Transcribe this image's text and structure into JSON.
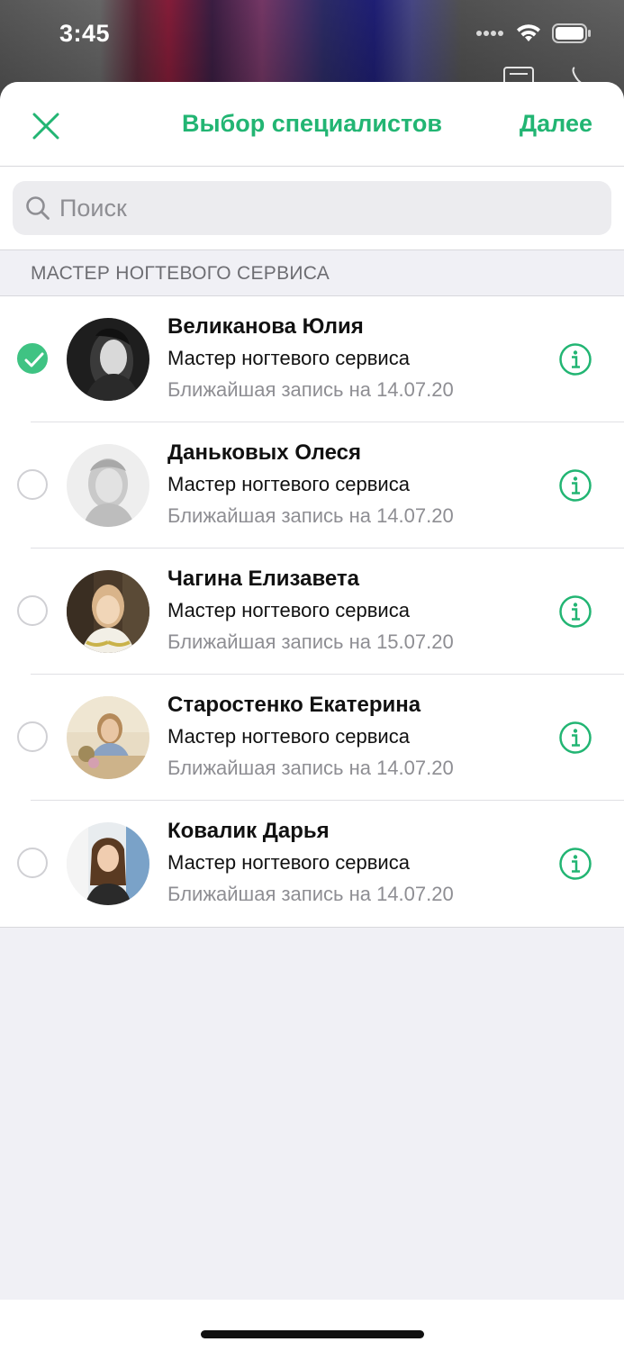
{
  "status_bar": {
    "time": "3:45"
  },
  "nav": {
    "title": "Выбор специалистов",
    "next_label": "Далее"
  },
  "search": {
    "placeholder": "Поиск",
    "value": ""
  },
  "section": {
    "title": "МАСТЕР НОГТЕВОГО СЕРВИСА"
  },
  "accent_color": "#22b573",
  "specialists": [
    {
      "name": "Великанова Юлия",
      "role": "Мастер ногтевого сервиса",
      "next": "Ближайшая запись на 14.07.20",
      "selected": true
    },
    {
      "name": "Даньковых Олеся",
      "role": "Мастер ногтевого сервиса",
      "next": "Ближайшая запись на 14.07.20",
      "selected": false
    },
    {
      "name": "Чагина Елизавета",
      "role": "Мастер ногтевого сервиса",
      "next": "Ближайшая запись на 15.07.20",
      "selected": false
    },
    {
      "name": "Старостенко Екатерина",
      "role": "Мастер ногтевого сервиса",
      "next": "Ближайшая запись на 14.07.20",
      "selected": false
    },
    {
      "name": "Ковалик Дарья",
      "role": "Мастер ногтевого сервиса",
      "next": "Ближайшая запись на 14.07.20",
      "selected": false
    }
  ]
}
